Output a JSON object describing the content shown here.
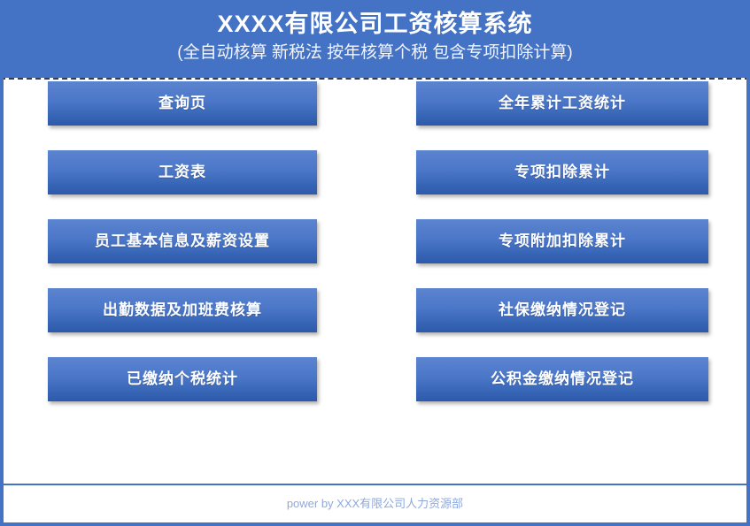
{
  "header": {
    "title": "XXXX有限公司工资核算系统",
    "subtitle": "(全自动核算 新税法 按年核算个税 包含专项扣除计算)",
    "band_color": "#4472c4",
    "title_color": "#ffffff"
  },
  "menu": {
    "left_column": [
      {
        "label": "查询页"
      },
      {
        "label": "工资表"
      },
      {
        "label": "员工基本信息及薪资设置"
      },
      {
        "label": "出勤数据及加班费核算"
      },
      {
        "label": "已缴纳个税统计"
      }
    ],
    "right_column": [
      {
        "label": "全年累计工资统计"
      },
      {
        "label": "专项扣除累计"
      },
      {
        "label": "专项附加扣除累计"
      },
      {
        "label": "社保缴纳情况登记"
      },
      {
        "label": "公积金缴纳情况登记"
      }
    ],
    "button_gradient_top": "#5b84d0",
    "button_gradient_bottom": "#2d5aab",
    "button_text_color": "#ffffff"
  },
  "footer": {
    "text": "power by XXX有限公司人力资源部",
    "text_color": "#8fa8dc",
    "rule_color": "#4472c4"
  }
}
